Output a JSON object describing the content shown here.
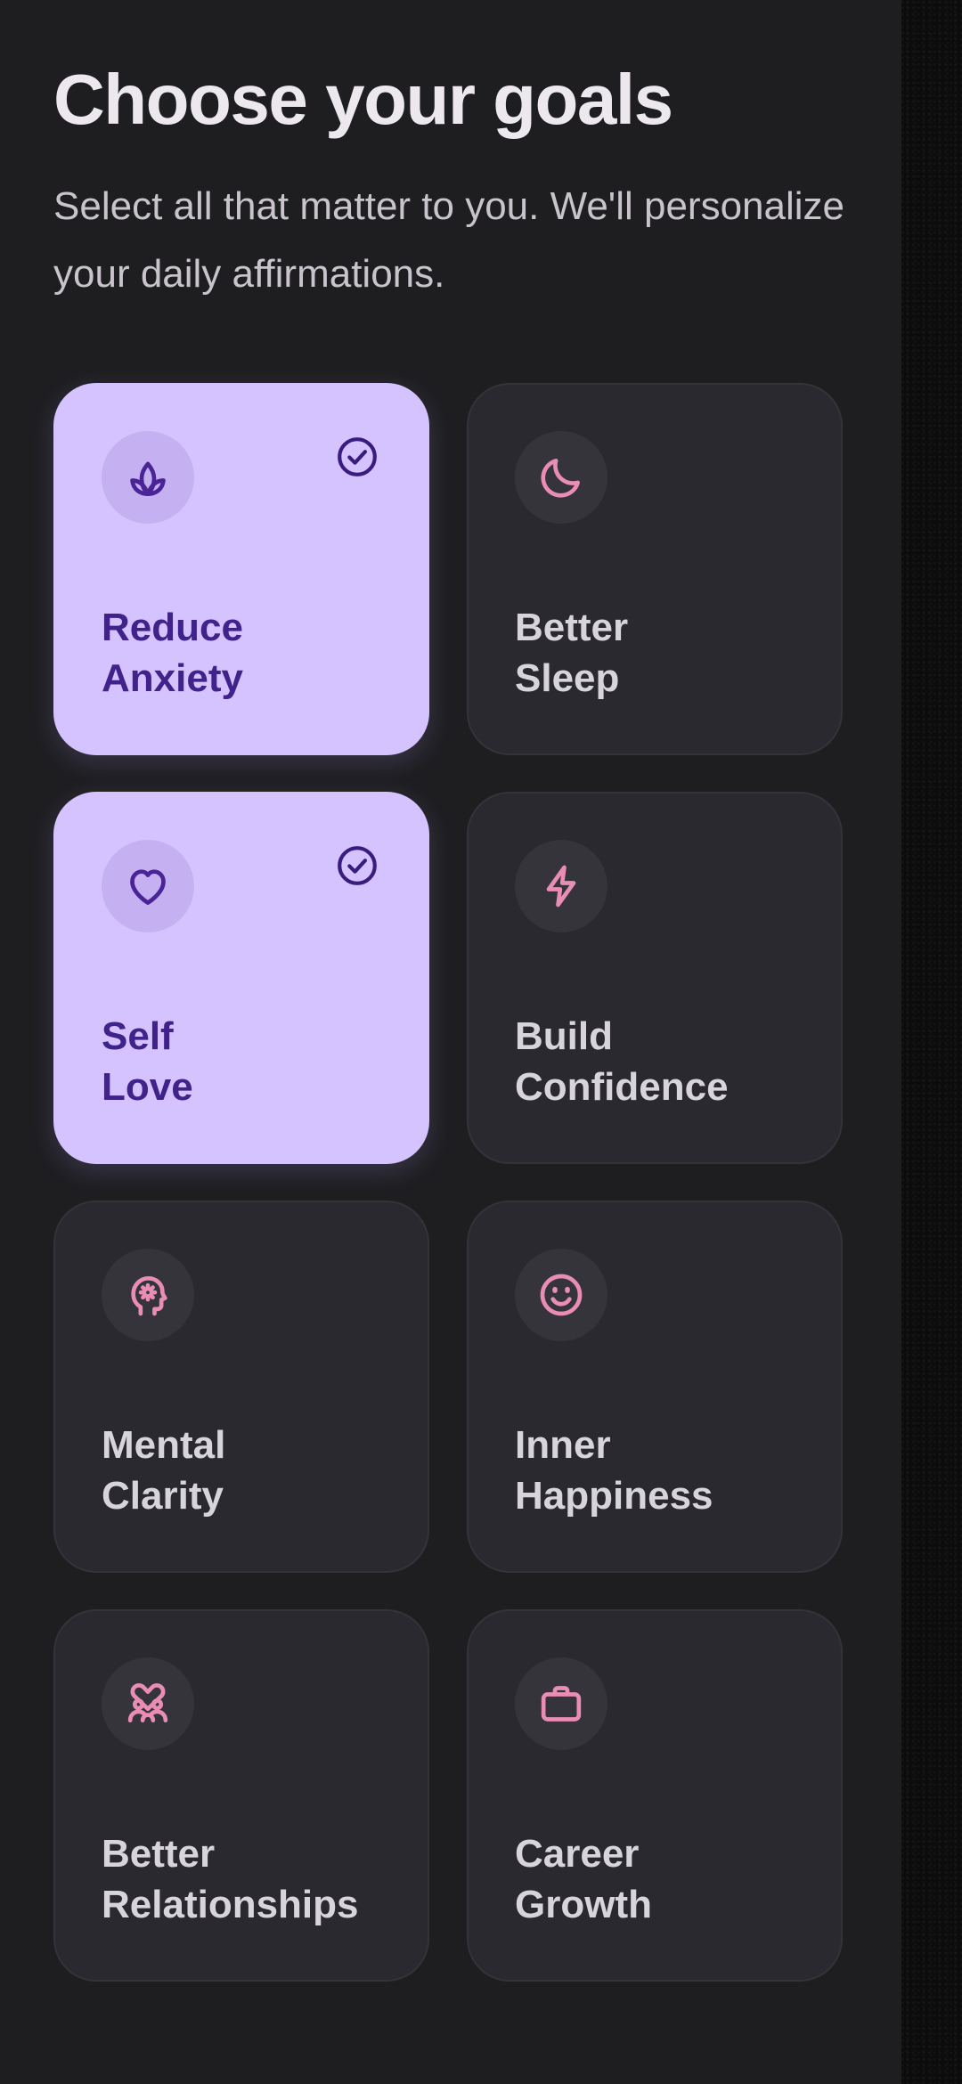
{
  "header": {
    "title": "Choose your goals",
    "subtitle": "Select all that matter to you. We'll personalize your daily affirmations."
  },
  "colors": {
    "background": "#1e1e21",
    "card": "#2a292f",
    "card_selected": "#d5c3ff",
    "icon_accent": "#e98db5",
    "selected_text": "#41218a",
    "title_text": "#ece8ee"
  },
  "goals": [
    {
      "line1": "Reduce",
      "line2": "Anxiety",
      "icon": "lotus-icon",
      "selected": true
    },
    {
      "line1": "Better",
      "line2": "Sleep",
      "icon": "moon-icon",
      "selected": false
    },
    {
      "line1": "Self",
      "line2": "Love",
      "icon": "heart-icon",
      "selected": true
    },
    {
      "line1": "Build",
      "line2": "Confidence",
      "icon": "lightning-icon",
      "selected": false
    },
    {
      "line1": "Mental",
      "line2": "Clarity",
      "icon": "head-gear-icon",
      "selected": false
    },
    {
      "line1": "Inner",
      "line2": "Happiness",
      "icon": "smile-icon",
      "selected": false
    },
    {
      "line1": "Better",
      "line2": "Relationships",
      "icon": "people-heart-icon",
      "selected": false
    },
    {
      "line1": "Career",
      "line2": "Growth",
      "icon": "briefcase-icon",
      "selected": false
    }
  ]
}
